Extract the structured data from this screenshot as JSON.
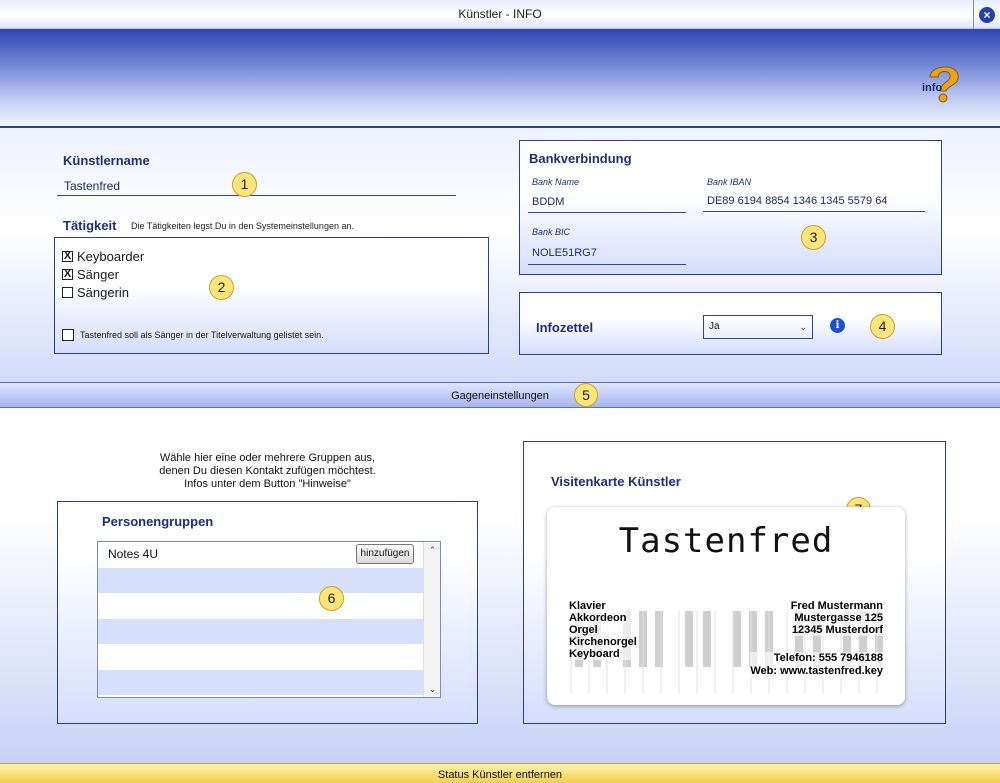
{
  "window": {
    "title": "Künstler - INFO",
    "close_icon": "close-icon"
  },
  "banner": {
    "logo_text": "info",
    "logo_icon": "info-question-mark-icon"
  },
  "artist": {
    "name_heading": "Künstlername",
    "name_value": "Tastenfred"
  },
  "activity": {
    "heading": "Tätigkeit",
    "hint": "Die Tätigkeiten legst Du in den Systemeinstellungen an.",
    "items": [
      {
        "label": "Keyboarder",
        "checked": true,
        "mark": "X"
      },
      {
        "label": "Sänger",
        "checked": true,
        "mark": "X"
      },
      {
        "label": "Sängerin",
        "checked": false,
        "mark": ""
      }
    ],
    "singer_listing": {
      "label": "Tastenfred soll als Sänger in der Titelverwaltung gelistet sein.",
      "checked": false
    }
  },
  "bank": {
    "heading": "Bankverbindung",
    "name_label": "Bank Name",
    "name_value": "BDDM",
    "iban_label": "Bank IBAN",
    "iban_value": "DE89 6194 8854 1346 1345 5579 64",
    "bic_label": "Bank BIC",
    "bic_value": "NOLE51RG7"
  },
  "infozettel": {
    "label": "Infozettel",
    "selected": "Ja",
    "info_glyph": "i"
  },
  "fee_bar": {
    "label": "Gageneinstellungen"
  },
  "groups": {
    "intro_line1": "Wähle hier eine oder mehrere Gruppen aus,",
    "intro_line2": "denen Du diesen Kontakt zufügen möchtest.",
    "intro_line3": "Infos unter dem Button \"Hinweise\"",
    "heading": "Personengruppen",
    "add_button": "hinzufügen",
    "rows": [
      "Notes 4U",
      "",
      "",
      "",
      "",
      ""
    ]
  },
  "card": {
    "heading": "Visitenkarte Künstler",
    "name": "Tastenfred",
    "instruments": [
      "Klavier",
      "Akkordeon",
      "Orgel",
      "Kirchenorgel",
      "Keyboard"
    ],
    "owner": "Fred Mustermann",
    "street": "Mustergasse 125",
    "city": "12345 Musterdorf",
    "phone": "Telefon: 555 7946188",
    "web": "Web: www.tastenfred.key"
  },
  "markers": [
    "1",
    "2",
    "3",
    "4",
    "5",
    "6",
    "7"
  ],
  "status_bar": {
    "label": "Status Künstler entfernen"
  },
  "colors": {
    "accent": "#2b3e92",
    "heading": "#1d2f7a",
    "marker": "#ffe57a",
    "status_bar": "#f1d04e"
  }
}
